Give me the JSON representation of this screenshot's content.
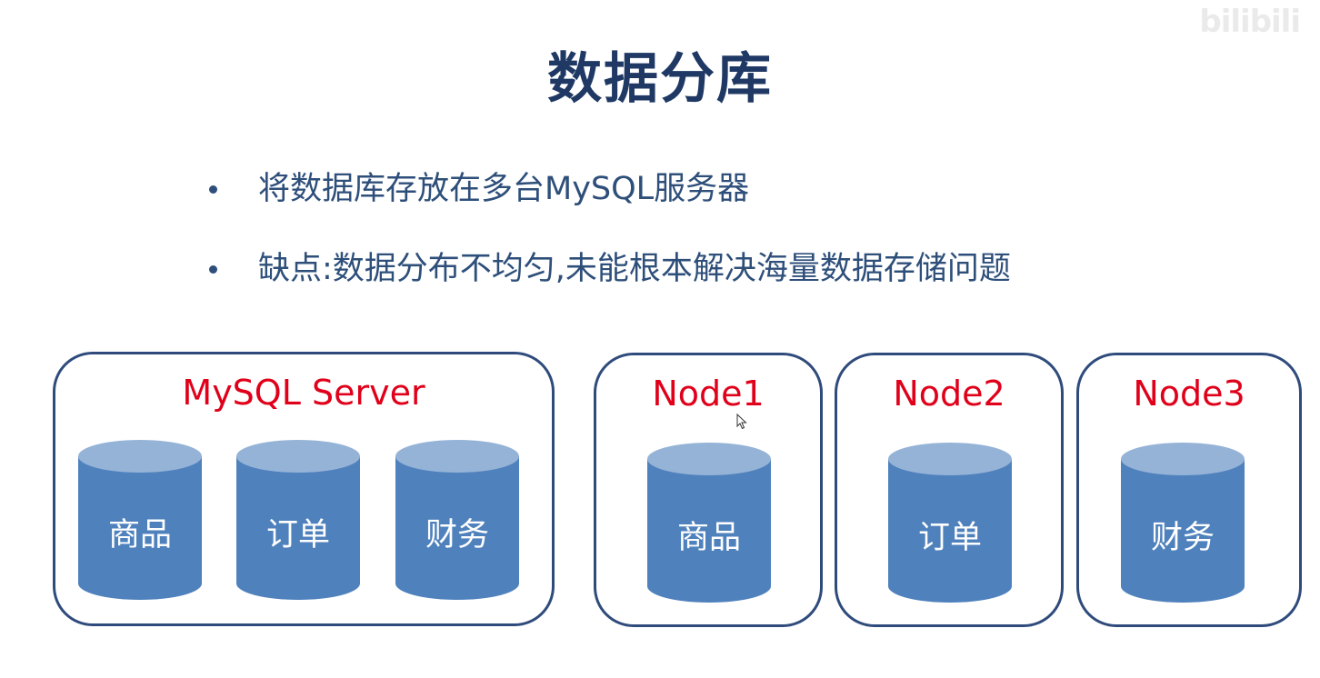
{
  "watermark": "bilibili",
  "title": "数据分库",
  "bullets": [
    {
      "text": "将数据库存放在多台MySQL服务器"
    },
    {
      "text": "缺点:数据分布不均匀,未能根本解决海量数据存储问题"
    }
  ],
  "servers": [
    {
      "label": "MySQL Server",
      "dbs": [
        "商品",
        "订单",
        "财务"
      ]
    },
    {
      "label": "Node1",
      "dbs": [
        "商品"
      ]
    },
    {
      "label": "Node2",
      "dbs": [
        "订单"
      ]
    },
    {
      "label": "Node3",
      "dbs": [
        "财务"
      ]
    }
  ],
  "colors": {
    "title": "#1f3864",
    "bullet_text": "#2e4f7a",
    "box_border": "#2f4b7c",
    "server_label": "#e0001a",
    "cylinder_body": "#4f81bd",
    "cylinder_top": "#95b3d7",
    "cylinder_text": "#ffffff"
  }
}
